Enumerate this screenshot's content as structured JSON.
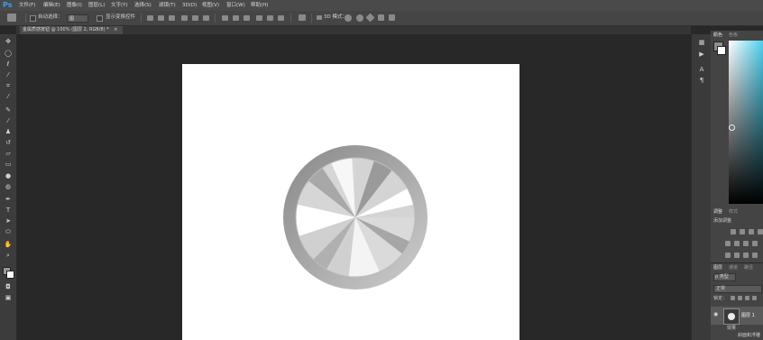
{
  "app": {
    "logo": "Ps"
  },
  "menu": [
    "文件(F)",
    "编辑(E)",
    "图像(I)",
    "图层(L)",
    "文字(Y)",
    "选择(S)",
    "滤镜(T)",
    "3D(D)",
    "视图(V)",
    "窗口(W)",
    "帮助(H)"
  ],
  "options": {
    "auto_select": "自动选择：",
    "auto_select_value": "图",
    "show_transform": "显示变换控件",
    "mode_3d": "3D 模式："
  },
  "document": {
    "tab_title": "金属质感按钮 @ 100% (图层 2, RGB/8) *",
    "close": "×"
  },
  "right": {
    "color_tab": "颜色",
    "swatches_tab": "色板",
    "adjust_tab": "调整",
    "styles_tab": "样式",
    "add_adjustment": "添加调整",
    "layers_tab": "图层",
    "channels_tab": "通道",
    "paths_tab": "路径",
    "kind_label": "ρ 类型",
    "blend_mode": "正常",
    "lock_label": "锁定：",
    "layer_name": "图层 1",
    "effects_label": "效果",
    "effect_item": "斜面和浮雕"
  },
  "colors": {
    "accent_logo": "#3aa0f0",
    "chrome": "#4a4a4a",
    "canvas_bg": "#282828"
  }
}
